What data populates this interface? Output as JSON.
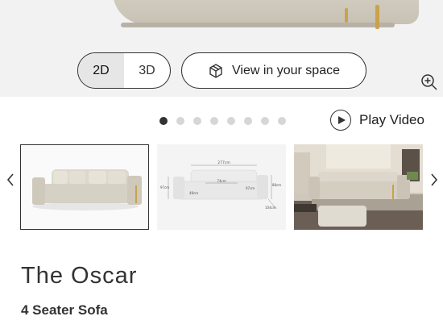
{
  "view_toggle": {
    "option_2d": "2D",
    "option_3d": "3D",
    "selected": "2D"
  },
  "ar_button": {
    "label": "View in your space",
    "icon": "cube-icon"
  },
  "zoom": {
    "icon": "zoom-in-icon"
  },
  "carousel": {
    "dot_count": 8,
    "active_index": 0
  },
  "video": {
    "label": "Play Video",
    "icon": "play-icon"
  },
  "thumbnails": [
    {
      "name": "sofa-front-view"
    },
    {
      "name": "sofa-dimensions-diagram"
    },
    {
      "name": "sofa-room-setting"
    }
  ],
  "dimensions": {
    "width_top": "277cm",
    "height_left": "97cm",
    "depth_right": "88cm",
    "seat_height": "48cm",
    "seat_width": "74cm",
    "arm_width": "97cm",
    "depth_bottom": "104cm"
  },
  "product": {
    "title": "The Oscar",
    "subtitle": "4 Seater Sofa"
  },
  "colors": {
    "accent": "#333333",
    "active_dot": "#333333",
    "inactive_dot": "#d6d6d6",
    "toggle_active_bg": "#e6e6e6",
    "gold_leg": "#c9a24a"
  }
}
